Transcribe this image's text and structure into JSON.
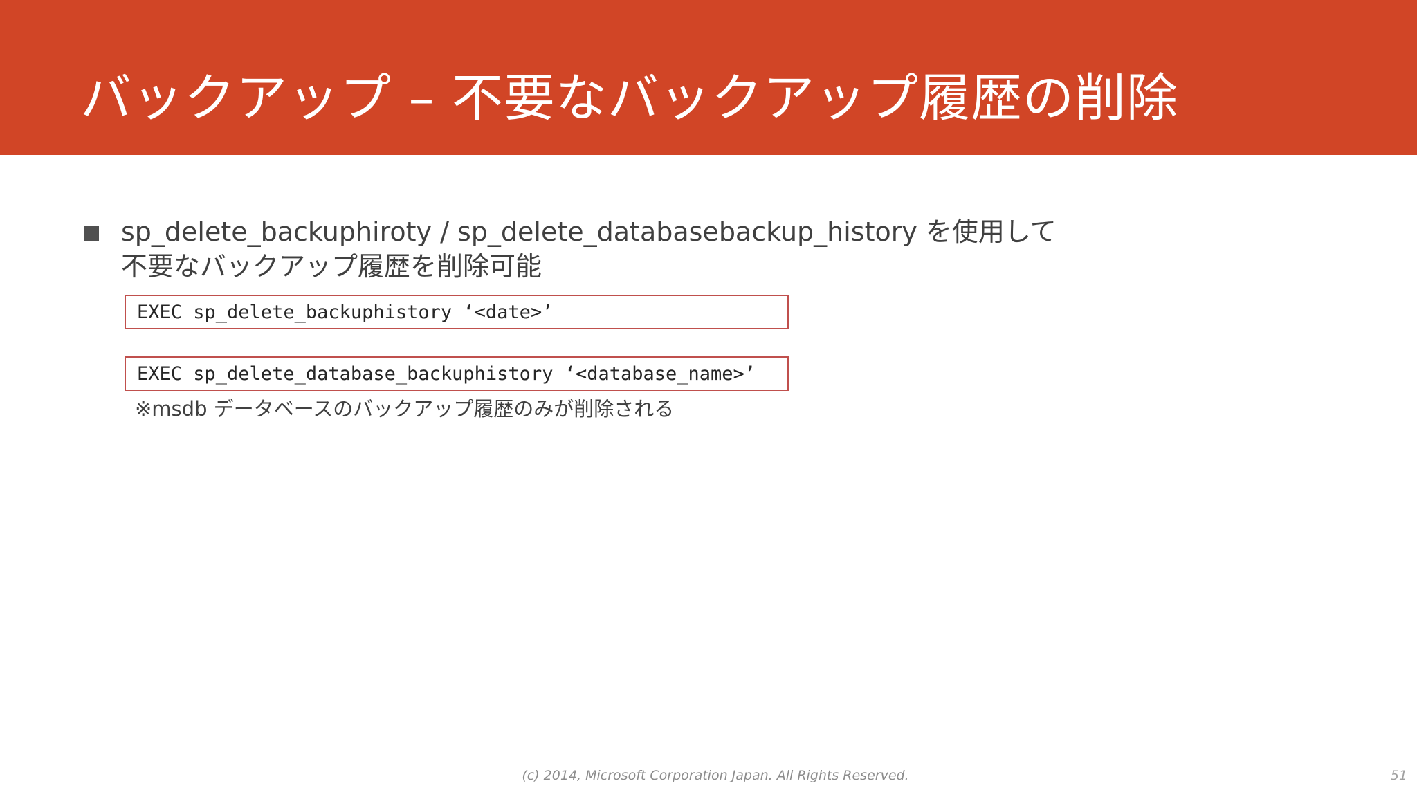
{
  "slide": {
    "title": "バックアップ – 不要なバックアップ履歴の削除",
    "accent_color": "#d14526",
    "bullet": {
      "icon": "square-bullet-icon",
      "line1": "sp_delete_backuphiroty / sp_delete_databasebackup_history を使用して",
      "line2": "不要なバックアップ履歴を削除可能"
    },
    "code_blocks": [
      "EXEC sp_delete_backuphistory ‘<date>’",
      "EXEC sp_delete_database_backuphistory ‘<database_name>’"
    ],
    "note": "※msdb データベースのバックアップ履歴のみが削除される",
    "footer": "(c) 2014, Microsoft Corporation Japan.  All Rights Reserved.",
    "page_number": "51"
  }
}
